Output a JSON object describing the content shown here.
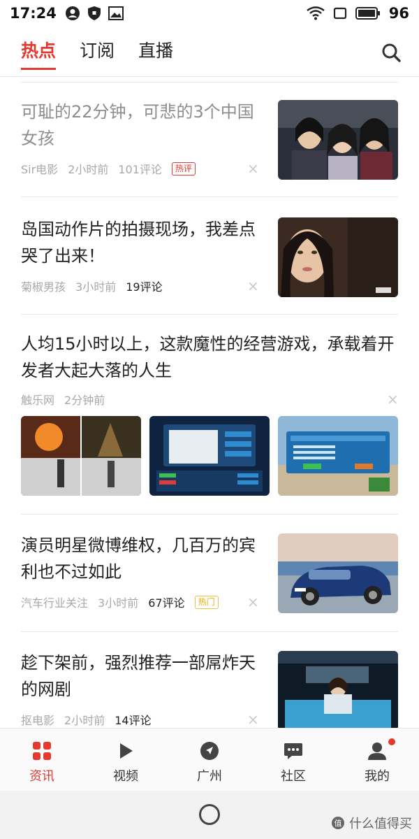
{
  "status_bar": {
    "time": "17:24",
    "battery": "96"
  },
  "tabs": [
    {
      "label": "热点",
      "active": true
    },
    {
      "label": "订阅",
      "active": false
    },
    {
      "label": "直播",
      "active": false
    }
  ],
  "feed": [
    {
      "title": "可耻的22分钟，可悲的3个中国女孩",
      "read": true,
      "source": "Sir电影",
      "time": "2小时前",
      "comments": "101评论",
      "badge": "热评",
      "thumb": "three-girls-film-still"
    },
    {
      "title": "岛国动作片的拍摄现场，我差点哭了出来！",
      "read": false,
      "source": "菊椒男孩",
      "time": "3小时前",
      "comments": "19评论",
      "badge": "",
      "thumb": "actress-closeup"
    },
    {
      "title": "人均15小时以上，这款魔性的经营游戏，承载着开发者大起大落的人生",
      "read": false,
      "source": "触乐网",
      "time": "2分钟前",
      "comments": "",
      "badge": "",
      "thumbs": [
        "game-concept-art",
        "game-menu-screen",
        "office-simulation-scene"
      ]
    },
    {
      "title": "演员明星微博维权，几百万的宾利也不过如此",
      "read": false,
      "source": "汽车行业关注",
      "time": "3小时前",
      "comments": "67评论",
      "badge": "热门",
      "thumb": "blue-bentley-car"
    },
    {
      "title": "趁下架前，强烈推荐一部屌炸天的网剧",
      "read": false,
      "source": "抠电影",
      "time": "2小时前",
      "comments": "14评论",
      "badge": "",
      "thumb": "scifi-drama-still"
    }
  ],
  "bottom_nav": [
    {
      "label": "资讯",
      "icon": "news-grid-icon",
      "active": true
    },
    {
      "label": "视频",
      "icon": "play-icon",
      "active": false
    },
    {
      "label": "广州",
      "icon": "location-compass-icon",
      "active": false
    },
    {
      "label": "社区",
      "icon": "chat-bubble-icon",
      "active": false
    },
    {
      "label": "我的",
      "icon": "user-icon",
      "active": false,
      "dot": true
    }
  ],
  "watermark": "什么值得买",
  "colors": {
    "accent": "#e3392f",
    "badge_trend": "#e8b000"
  }
}
